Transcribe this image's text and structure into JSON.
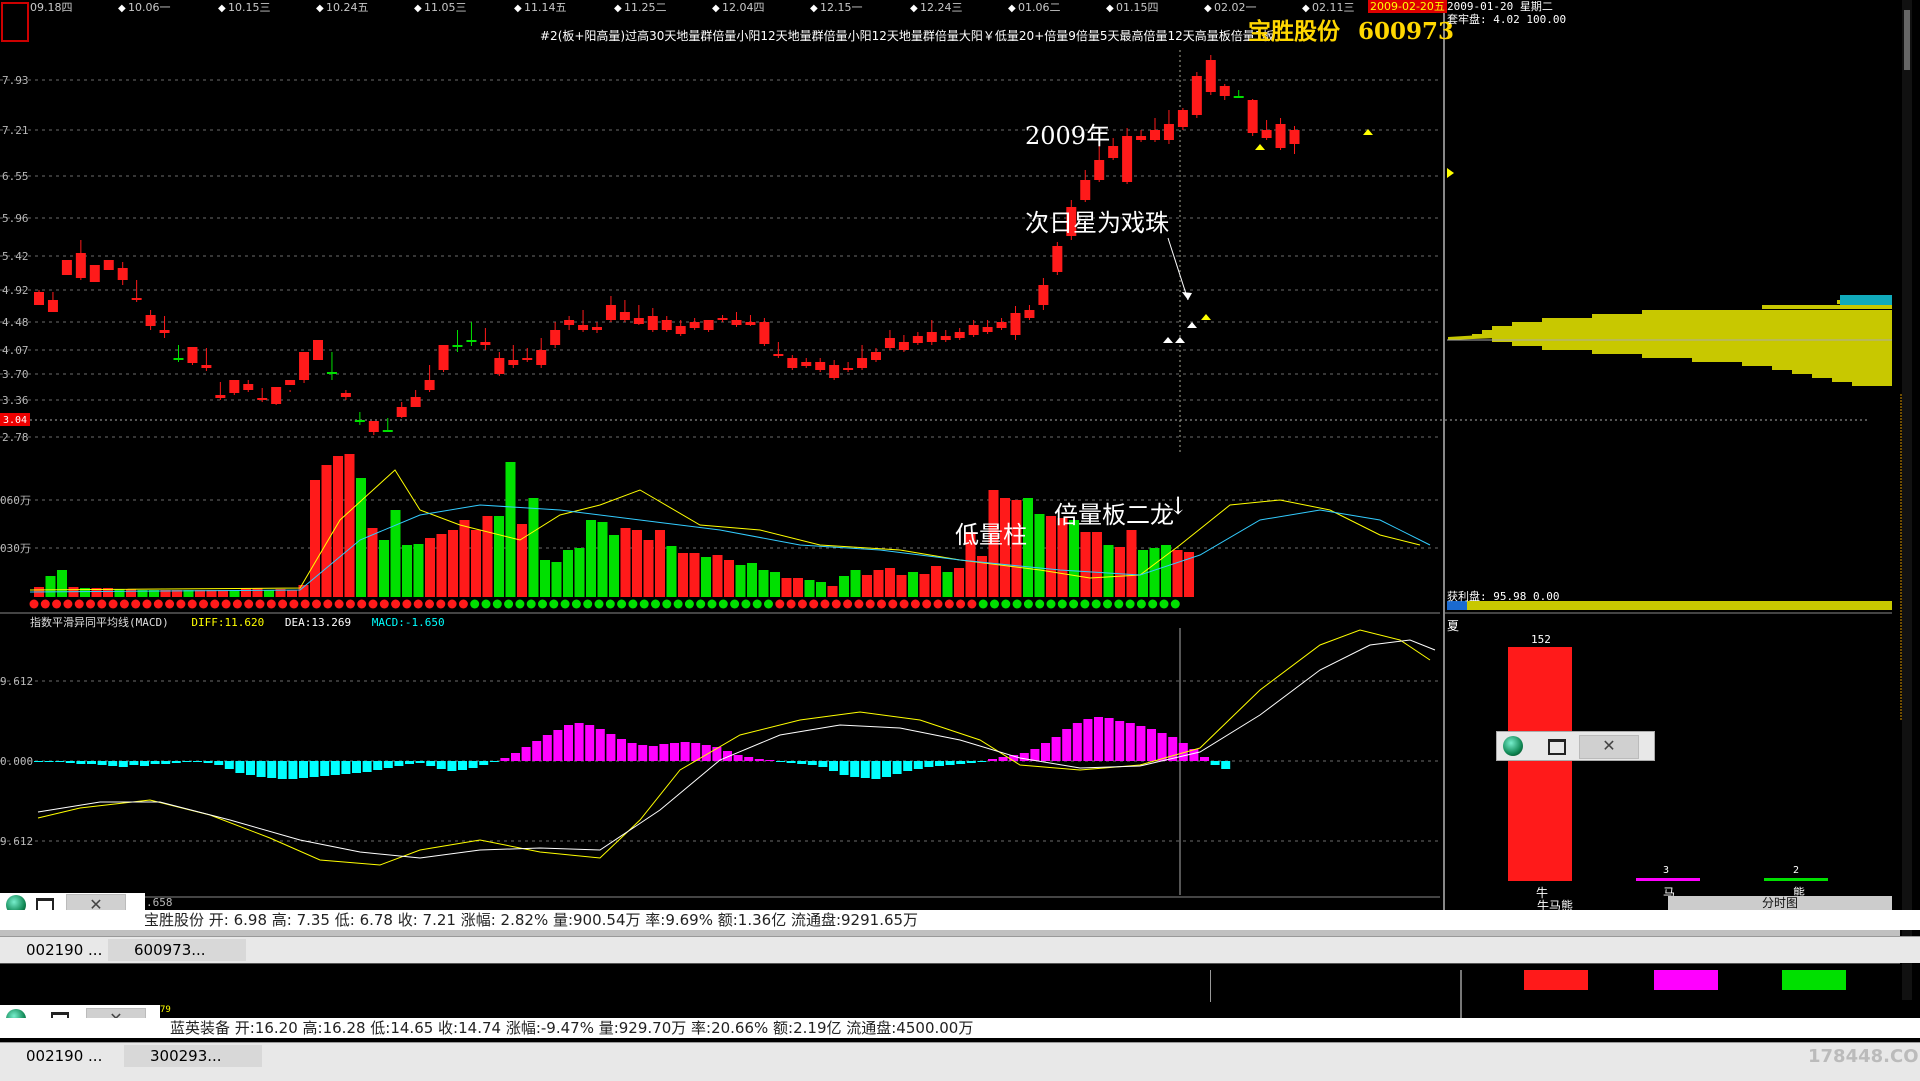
{
  "header": {
    "stock_name": "宝胜股份",
    "stock_code": "600973",
    "current_date": "2009-02-20五",
    "formula_text": "#2(板+阳高量)过高30天地量群倍量小阳12天地量群倍量小阳12天地量群倍量大阳￥低量20+倍量9倍量5天最高倍量12天高量板倍量1板",
    "date_labels": [
      "09.18四",
      "10.06一",
      "10.15三",
      "10.24五",
      "11.05三",
      "11.14五",
      "11.25二",
      "12.04四",
      "12.15一",
      "12.24三",
      "01.06二",
      "01.15四",
      "02.02一",
      "02.11三"
    ]
  },
  "price_axis": {
    "ticks": [
      "7.93",
      "7.21",
      "6.55",
      "5.96",
      "5.42",
      "4.92",
      "4.48",
      "4.07",
      "3.70",
      "3.36",
      "2.78"
    ],
    "current_price_tag": "3.04"
  },
  "volume_axis": {
    "ticks": [
      "060万",
      "030万"
    ]
  },
  "macd": {
    "title": "指数平滑异同平均线(MACD)",
    "diff_label": "DIFF:11.620",
    "dea_label": "DEA:13.269",
    "macd_label": "MACD:-1.650",
    "ticks": [
      "9.612",
      "0.000",
      "9.612"
    ],
    "bottom_tick": ".658"
  },
  "annotations": {
    "year": "2009年",
    "star": "次日星为戏珠",
    "low_volume": "低量柱",
    "double_volume": "倍量板二龙",
    "down_arrow": "↓"
  },
  "right_panel": {
    "date_line": "2009-01-20 星期二",
    "cost_line": "套牢盘: 4.02 100.00",
    "profit_line": "获利盘: 95.98 0.00",
    "header_char": "夏",
    "bar_value": "152",
    "small_val_1": "3",
    "small_val_2": "2",
    "labels": [
      "牛",
      "马",
      "熊"
    ],
    "footer_left": "牛马熊",
    "footer_right": "分时图"
  },
  "status_bar_1": {
    "text": "宝胜股份  开: 6.98  高: 7.35  低: 6.78  收: 7.21  涨幅: 2.82%  量:900.54万  率:9.69%  额:1.36亿  流通盘:9291.65万"
  },
  "status_bar_2": {
    "text": "蓝英装备  开:16.20  高:16.28  低:14.65  收:14.74  涨幅:-9.47%  量:929.70万  率:20.66%  额:2.19亿  流通盘:4500.00万",
    "prefix": "79"
  },
  "taskbar_1": {
    "items": [
      "002190 ...",
      "600973..."
    ]
  },
  "taskbar_2": {
    "items": [
      "002190 ...",
      "300293..."
    ]
  },
  "mini_windows": {
    "close_symbol": "✕"
  },
  "watermark": "178448.COM",
  "colors": {
    "up": "#ff1a1a",
    "down": "#00e000",
    "macd_pos": "#ff00ff",
    "macd_neg": "#00ffff",
    "title": "#ffd700",
    "chip": "#c8c800"
  }
}
